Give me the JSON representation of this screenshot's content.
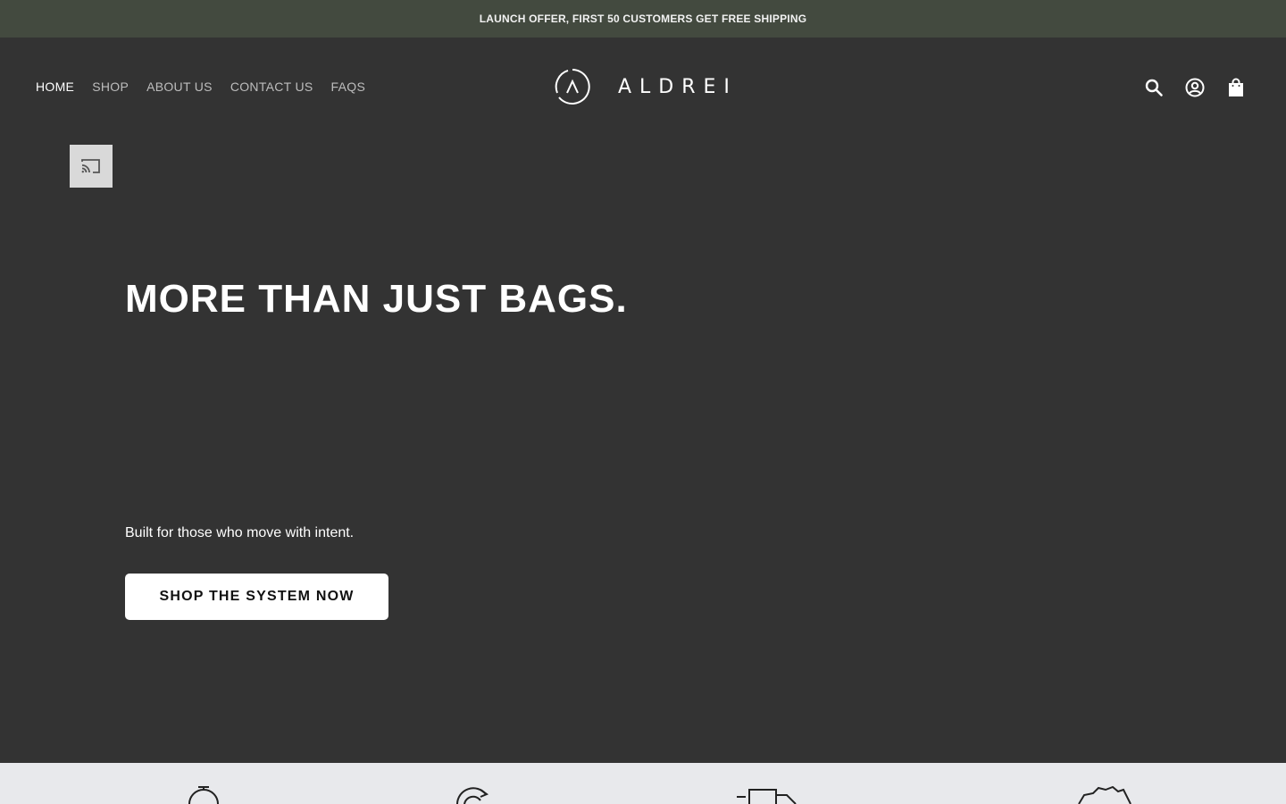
{
  "announcement": {
    "text": "LAUNCH OFFER, FIRST 50 CUSTOMERS GET FREE SHIPPING"
  },
  "nav": {
    "items": [
      {
        "label": "HOME",
        "active": true
      },
      {
        "label": "SHOP",
        "active": false
      },
      {
        "label": "ABOUT US",
        "active": false
      },
      {
        "label": "CONTACT US",
        "active": false
      },
      {
        "label": "FAQS",
        "active": false
      }
    ]
  },
  "logo": {
    "text": "ALDREI",
    "mark_icon": "aldrei-logo-icon"
  },
  "header_icons": [
    "search-icon",
    "account-icon",
    "cart-icon"
  ],
  "cast": {
    "icon": "cast-icon"
  },
  "hero": {
    "title": "MORE THAN JUST BAGS.",
    "subtitle": "Built for those who move with intent.",
    "cta_label": "SHOP THE SYSTEM NOW"
  },
  "features": {
    "icons": [
      "stopwatch-icon",
      "recycle-icon",
      "delivery-truck-icon",
      "australia-map-icon"
    ]
  },
  "colors": {
    "announcement_bg": "#434a3f",
    "page_bg": "#333333",
    "features_bg": "#e8e9ec",
    "cta_bg": "#ffffff"
  }
}
